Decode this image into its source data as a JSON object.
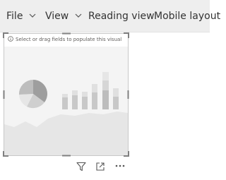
{
  "toolbar": {
    "file_label": "File",
    "view_label": "View",
    "reading_view_label": "Reading view",
    "mobile_layout_label": "Mobile layout"
  },
  "visual": {
    "placeholder_message": "Select or drag fields to populate this visual"
  },
  "icons": {
    "info": "info-icon",
    "chevron": "chevron-down-icon",
    "filter": "filter-icon",
    "focus_mode": "focus-mode-icon",
    "more_options": "more-options-icon"
  },
  "colors": {
    "toolbar_bg": "#eeeeee",
    "text": "#333333",
    "placeholder_art_light": "#e6e6e6",
    "placeholder_art_mid": "#c8c8c8",
    "placeholder_art_dark": "#a6a6a6",
    "handle": "#808080"
  }
}
